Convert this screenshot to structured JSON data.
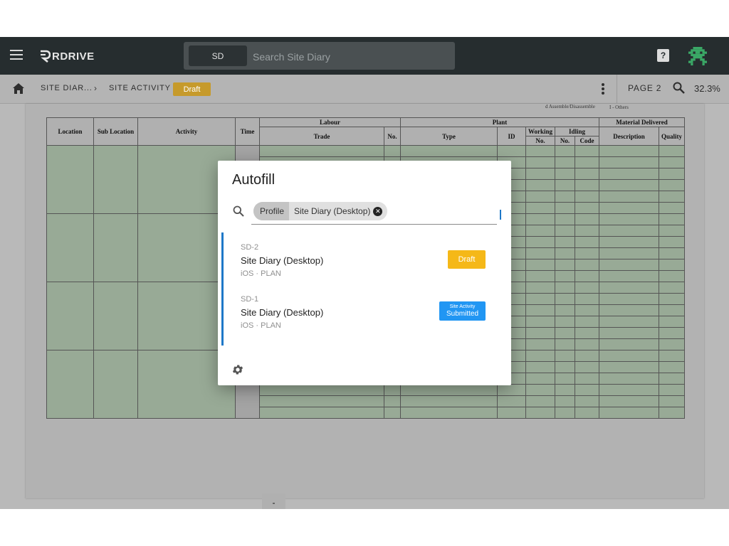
{
  "header": {
    "brand": "RDRIVE",
    "search": {
      "scope": "SD",
      "placeholder": "Search Site Diary"
    },
    "help_label": "?"
  },
  "breadcrumb": {
    "items": [
      "SITE DIAR...",
      "SITE ACTIVITY"
    ],
    "separator": "›",
    "status": "Draft"
  },
  "viewer": {
    "page": "PAGE 2",
    "zoom": "32.3%"
  },
  "document": {
    "notes": [
      "d Assemble/Disassemble",
      "I - Others"
    ],
    "columns": {
      "location": "Location",
      "sub_location": "Sub Location",
      "activity": "Activity",
      "time": "Time",
      "labour": "Labour",
      "trade": "Trade",
      "no": "No.",
      "plant": "Plant",
      "type": "Type",
      "id": "ID",
      "working": "Working",
      "idling": "Idling",
      "working_no": "No.",
      "idling_no": "No.",
      "code": "Code",
      "material_delivered": "Material Delivered",
      "description": "Description",
      "quality": "Quality"
    },
    "time_value": "-"
  },
  "dialog": {
    "title": "Autofill",
    "filter": {
      "label": "Profile",
      "value": "Site Diary (Desktop)",
      "clear_icon": "close-circle-icon"
    },
    "items": [
      {
        "id": "SD-2",
        "title": "Site Diary (Desktop)",
        "meta": "iOS · PLAN",
        "status": "Draft",
        "status_color": "#f5b818"
      },
      {
        "id": "SD-1",
        "title": "Site Diary (Desktop)",
        "meta": "iOS · PLAN",
        "status_line1": "Site Activity",
        "status_line2": "Submitted",
        "status_color": "#2196f3"
      }
    ]
  },
  "colors": {
    "topbar": "#262d2f",
    "accent": "#1e78c8",
    "draft": "#f5b818",
    "submitted": "#2196f3",
    "sheet_fill": "#98aa96"
  }
}
